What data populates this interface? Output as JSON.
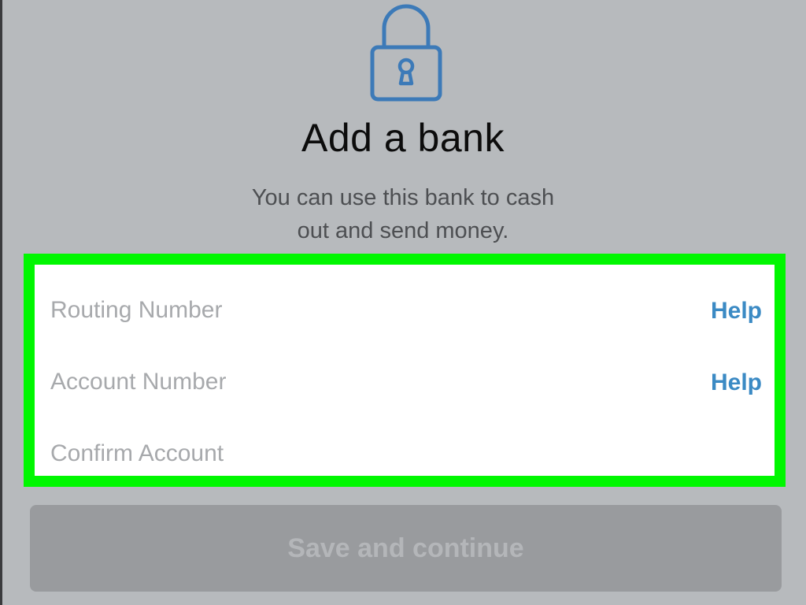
{
  "header": {
    "icon": "lock-icon",
    "title": "Add a bank",
    "subtitle_line1": "You can use this bank to cash",
    "subtitle_line2": "out and send money."
  },
  "form": {
    "routing": {
      "placeholder": "Routing Number",
      "value": "",
      "help_label": "Help"
    },
    "account": {
      "placeholder": "Account Number",
      "value": "",
      "help_label": "Help"
    },
    "confirm": {
      "placeholder": "Confirm Account",
      "value": ""
    },
    "highlight_color": "#00f700"
  },
  "actions": {
    "save_label": "Save and continue",
    "save_enabled": false
  },
  "colors": {
    "background": "#b7babd",
    "accent": "#3b8ac4",
    "button_disabled": "#999b9e"
  }
}
